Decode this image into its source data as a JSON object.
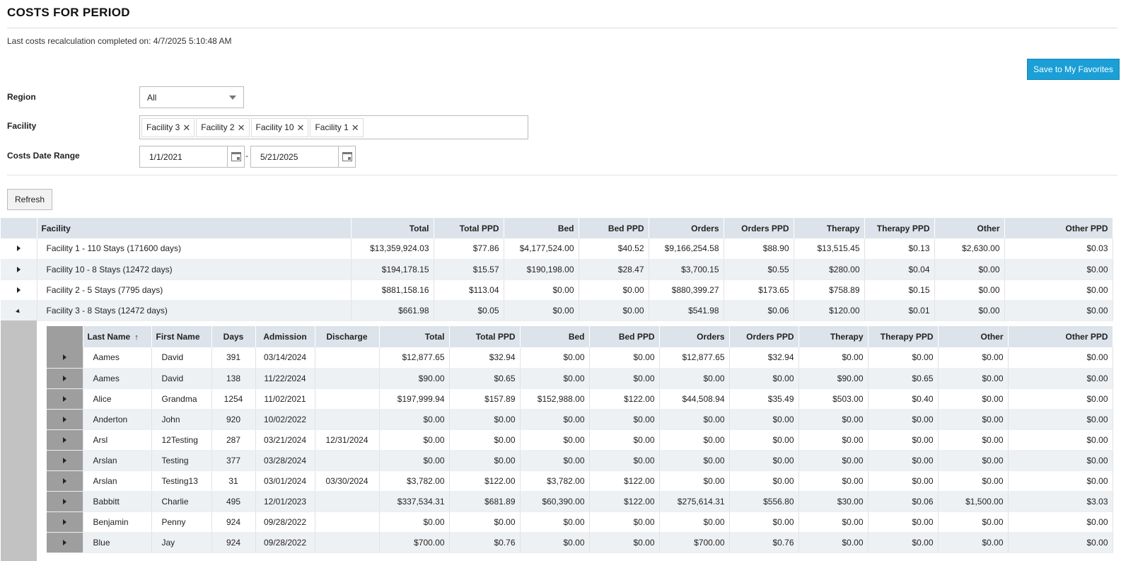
{
  "header": {
    "title": "COSTS FOR PERIOD",
    "recalc_text": "Last costs recalculation completed on: 4/7/2025 5:10:48 AM",
    "favorites_label": "Save to My Favorites"
  },
  "filters": {
    "region_label": "Region",
    "region_value": "All",
    "facility_label": "Facility",
    "facility_chips": [
      "Facility 3",
      "Facility 2",
      "Facility 10",
      "Facility 1"
    ],
    "date_label": "Costs Date Range",
    "date_from": "1/1/2021",
    "date_separator": "-",
    "date_to": "5/21/2025",
    "refresh_label": "Refresh"
  },
  "grid": {
    "columns": [
      "Facility",
      "Total",
      "Total PPD",
      "Bed",
      "Bed PPD",
      "Orders",
      "Orders PPD",
      "Therapy",
      "Therapy PPD",
      "Other",
      "Other PPD"
    ],
    "rows": [
      {
        "facility": "Facility 1 - 110 Stays (171600 days)",
        "total": "$13,359,924.03",
        "total_ppd": "$77.86",
        "bed": "$4,177,524.00",
        "bed_ppd": "$40.52",
        "orders": "$9,166,254.58",
        "orders_ppd": "$88.90",
        "therapy": "$13,515.45",
        "therapy_ppd": "$0.13",
        "other": "$2,630.00",
        "other_ppd": "$0.03",
        "expanded": false
      },
      {
        "facility": "Facility 10 - 8 Stays (12472 days)",
        "total": "$194,178.15",
        "total_ppd": "$15.57",
        "bed": "$190,198.00",
        "bed_ppd": "$28.47",
        "orders": "$3,700.15",
        "orders_ppd": "$0.55",
        "therapy": "$280.00",
        "therapy_ppd": "$0.04",
        "other": "$0.00",
        "other_ppd": "$0.00",
        "expanded": false
      },
      {
        "facility": "Facility 2 - 5 Stays (7795 days)",
        "total": "$881,158.16",
        "total_ppd": "$113.04",
        "bed": "$0.00",
        "bed_ppd": "$0.00",
        "orders": "$880,399.27",
        "orders_ppd": "$173.65",
        "therapy": "$758.89",
        "therapy_ppd": "$0.15",
        "other": "$0.00",
        "other_ppd": "$0.00",
        "expanded": false
      },
      {
        "facility": "Facility 3 - 8 Stays (12472 days)",
        "total": "$661.98",
        "total_ppd": "$0.05",
        "bed": "$0.00",
        "bed_ppd": "$0.00",
        "orders": "$541.98",
        "orders_ppd": "$0.06",
        "therapy": "$120.00",
        "therapy_ppd": "$0.01",
        "other": "$0.00",
        "other_ppd": "$0.00",
        "expanded": true
      }
    ]
  },
  "nested": {
    "columns": [
      "Last Name",
      "First Name",
      "Days",
      "Admission",
      "Discharge",
      "Total",
      "Total PPD",
      "Bed",
      "Bed PPD",
      "Orders",
      "Orders PPD",
      "Therapy",
      "Therapy PPD",
      "Other",
      "Other PPD"
    ],
    "sort_icon": "↑",
    "rows": [
      {
        "last": "Aames",
        "first": "David",
        "days": "391",
        "adm": "03/14/2024",
        "dis": "",
        "total": "$12,877.65",
        "total_ppd": "$32.94",
        "bed": "$0.00",
        "bed_ppd": "$0.00",
        "orders": "$12,877.65",
        "orders_ppd": "$32.94",
        "therapy": "$0.00",
        "therapy_ppd": "$0.00",
        "other": "$0.00",
        "other_ppd": "$0.00"
      },
      {
        "last": "Aames",
        "first": "David",
        "days": "138",
        "adm": "11/22/2024",
        "dis": "",
        "total": "$90.00",
        "total_ppd": "$0.65",
        "bed": "$0.00",
        "bed_ppd": "$0.00",
        "orders": "$0.00",
        "orders_ppd": "$0.00",
        "therapy": "$90.00",
        "therapy_ppd": "$0.65",
        "other": "$0.00",
        "other_ppd": "$0.00"
      },
      {
        "last": "Alice",
        "first": "Grandma",
        "days": "1254",
        "adm": "11/02/2021",
        "dis": "",
        "total": "$197,999.94",
        "total_ppd": "$157.89",
        "bed": "$152,988.00",
        "bed_ppd": "$122.00",
        "orders": "$44,508.94",
        "orders_ppd": "$35.49",
        "therapy": "$503.00",
        "therapy_ppd": "$0.40",
        "other": "$0.00",
        "other_ppd": "$0.00"
      },
      {
        "last": "Anderton",
        "first": "John",
        "days": "920",
        "adm": "10/02/2022",
        "dis": "",
        "total": "$0.00",
        "total_ppd": "$0.00",
        "bed": "$0.00",
        "bed_ppd": "$0.00",
        "orders": "$0.00",
        "orders_ppd": "$0.00",
        "therapy": "$0.00",
        "therapy_ppd": "$0.00",
        "other": "$0.00",
        "other_ppd": "$0.00"
      },
      {
        "last": "Arsl",
        "first": "12Testing",
        "days": "287",
        "adm": "03/21/2024",
        "dis": "12/31/2024",
        "total": "$0.00",
        "total_ppd": "$0.00",
        "bed": "$0.00",
        "bed_ppd": "$0.00",
        "orders": "$0.00",
        "orders_ppd": "$0.00",
        "therapy": "$0.00",
        "therapy_ppd": "$0.00",
        "other": "$0.00",
        "other_ppd": "$0.00"
      },
      {
        "last": "Arslan",
        "first": "Testing",
        "days": "377",
        "adm": "03/28/2024",
        "dis": "",
        "total": "$0.00",
        "total_ppd": "$0.00",
        "bed": "$0.00",
        "bed_ppd": "$0.00",
        "orders": "$0.00",
        "orders_ppd": "$0.00",
        "therapy": "$0.00",
        "therapy_ppd": "$0.00",
        "other": "$0.00",
        "other_ppd": "$0.00"
      },
      {
        "last": "Arslan",
        "first": "Testing13",
        "days": "31",
        "adm": "03/01/2024",
        "dis": "03/30/2024",
        "total": "$3,782.00",
        "total_ppd": "$122.00",
        "bed": "$3,782.00",
        "bed_ppd": "$122.00",
        "orders": "$0.00",
        "orders_ppd": "$0.00",
        "therapy": "$0.00",
        "therapy_ppd": "$0.00",
        "other": "$0.00",
        "other_ppd": "$0.00"
      },
      {
        "last": "Babbitt",
        "first": "Charlie",
        "days": "495",
        "adm": "12/01/2023",
        "dis": "",
        "total": "$337,534.31",
        "total_ppd": "$681.89",
        "bed": "$60,390.00",
        "bed_ppd": "$122.00",
        "orders": "$275,614.31",
        "orders_ppd": "$556.80",
        "therapy": "$30.00",
        "therapy_ppd": "$0.06",
        "other": "$1,500.00",
        "other_ppd": "$3.03"
      },
      {
        "last": "Benjamin",
        "first": "Penny",
        "days": "924",
        "adm": "09/28/2022",
        "dis": "",
        "total": "$0.00",
        "total_ppd": "$0.00",
        "bed": "$0.00",
        "bed_ppd": "$0.00",
        "orders": "$0.00",
        "orders_ppd": "$0.00",
        "therapy": "$0.00",
        "therapy_ppd": "$0.00",
        "other": "$0.00",
        "other_ppd": "$0.00"
      },
      {
        "last": "Blue",
        "first": "Jay",
        "days": "924",
        "adm": "09/28/2022",
        "dis": "",
        "total": "$700.00",
        "total_ppd": "$0.76",
        "bed": "$0.00",
        "bed_ppd": "$0.00",
        "orders": "$700.00",
        "orders_ppd": "$0.76",
        "therapy": "$0.00",
        "therapy_ppd": "$0.00",
        "other": "$0.00",
        "other_ppd": "$0.00"
      }
    ]
  },
  "icons": {
    "dropdown": "chevron-down-icon",
    "remove_chip": "close-icon",
    "calendar": "calendar-icon",
    "expand": "expand-arrow-icon",
    "collapse": "collapse-arrow-icon",
    "sort": "sort-ascending-icon"
  },
  "colors": {
    "accent": "#1a9fd6",
    "header_bg": "#dde3ea",
    "alt_row_bg": "#eef1f4",
    "nested_gutter": "#c2c2c2"
  }
}
